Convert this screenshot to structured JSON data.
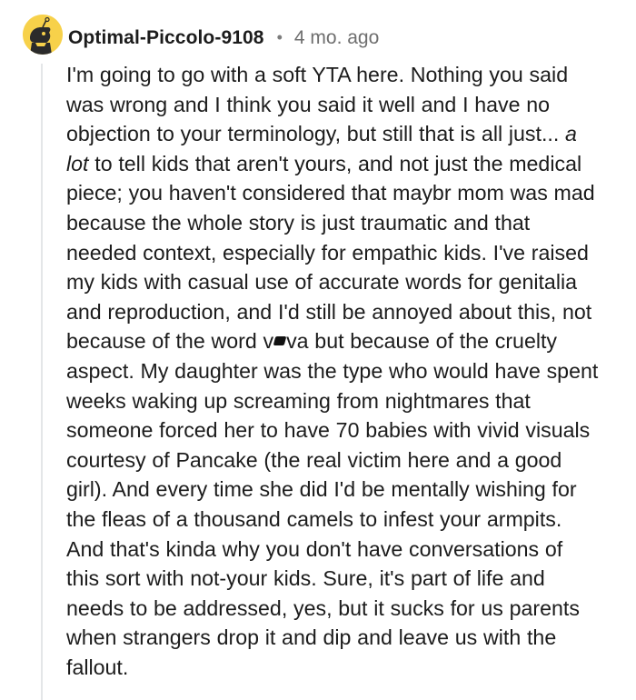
{
  "comment": {
    "username": "Optimal-Piccolo-9108",
    "separator": "•",
    "timestamp": "4 mo. ago",
    "avatar_icon": "snoo-avatar-icon",
    "avatar_color": "#f7d14a",
    "lines": [
      "I'm going to go with a soft YTA here. Nothing you said",
      "was wrong and I think you said it well and I have no",
      "objection to your terminology, but still that is all just...",
      "a",
      "lot",
      "to tell kids that aren't yours, and not just the medical",
      "piece; you haven't considered that maybr mom was mad",
      "because the whole story is just traumatic and that",
      "needed context, especially for empathic kids. I've raised",
      "my kids with casual use of accurate words for genitalia",
      "and reproduction, and I'd still be annoyed about this, not",
      "because of the word v",
      "va but because of the cruelty",
      "aspect. My daughter was the type who would have spent",
      "weeks waking up screaming from nightmares that",
      "someone forced her to have 70 babies with vivid visuals",
      "courtesy of Pancake (the real victim here and a good",
      "girl). And every time she did I'd be mentally wishing for",
      "the fleas of a thousand camels to infest your armpits.",
      "And that's kinda why you don't have conversations of",
      "this sort with not-your kids. Sure, it's part of life and",
      "needs to be addressed, yes, but it sucks for us parents",
      "when strangers drop it and dip and leave us with the",
      "fallout."
    ]
  }
}
